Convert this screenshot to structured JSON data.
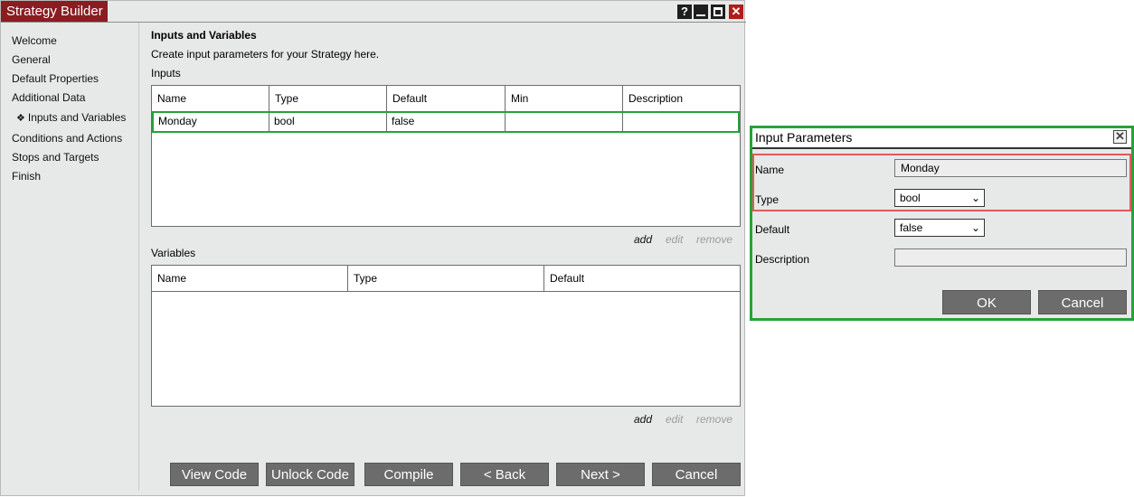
{
  "window": {
    "title": "Strategy Builder",
    "controls": {
      "help": "?",
      "close": "✕"
    }
  },
  "sidebar": {
    "items": [
      {
        "label": "Welcome"
      },
      {
        "label": "General"
      },
      {
        "label": "Default Properties"
      },
      {
        "label": "Additional Data"
      },
      {
        "label": "Inputs and Variables",
        "active": true,
        "marker": "❖"
      },
      {
        "label": "Conditions and Actions"
      },
      {
        "label": "Stops and Targets"
      },
      {
        "label": "Finish"
      }
    ]
  },
  "main": {
    "title": "Inputs and Variables",
    "description": "Create input parameters for your Strategy here.",
    "inputs": {
      "label": "Inputs",
      "columns": [
        "Name",
        "Type",
        "Default",
        "Min",
        "Description"
      ],
      "rows": [
        [
          "Monday",
          "bool",
          "false",
          "",
          ""
        ]
      ],
      "actions": {
        "add": "add",
        "edit": "edit",
        "remove": "remove"
      }
    },
    "variables": {
      "label": "Variables",
      "columns": [
        "Name",
        "Type",
        "Default"
      ],
      "rows": [],
      "actions": {
        "add": "add",
        "edit": "edit",
        "remove": "remove"
      }
    },
    "buttons": {
      "view_code": "View Code",
      "unlock_code": "Unlock Code",
      "compile": "Compile",
      "back": "< Back",
      "next": "Next >",
      "cancel": "Cancel"
    }
  },
  "dialog": {
    "title": "Input Parameters",
    "close": "✕",
    "fields": {
      "name": {
        "label": "Name",
        "value": "Monday"
      },
      "type": {
        "label": "Type",
        "value": "bool"
      },
      "default": {
        "label": "Default",
        "value": "false"
      },
      "description": {
        "label": "Description",
        "value": ""
      }
    },
    "buttons": {
      "ok": "OK",
      "cancel": "Cancel"
    }
  },
  "colors": {
    "title_tab": "#8a1c22",
    "selection_border": "#29a03a",
    "dialog_highlight": "#e25a5a",
    "button_bg": "#6c6c6c",
    "panel_bg": "#e7e8e8"
  }
}
